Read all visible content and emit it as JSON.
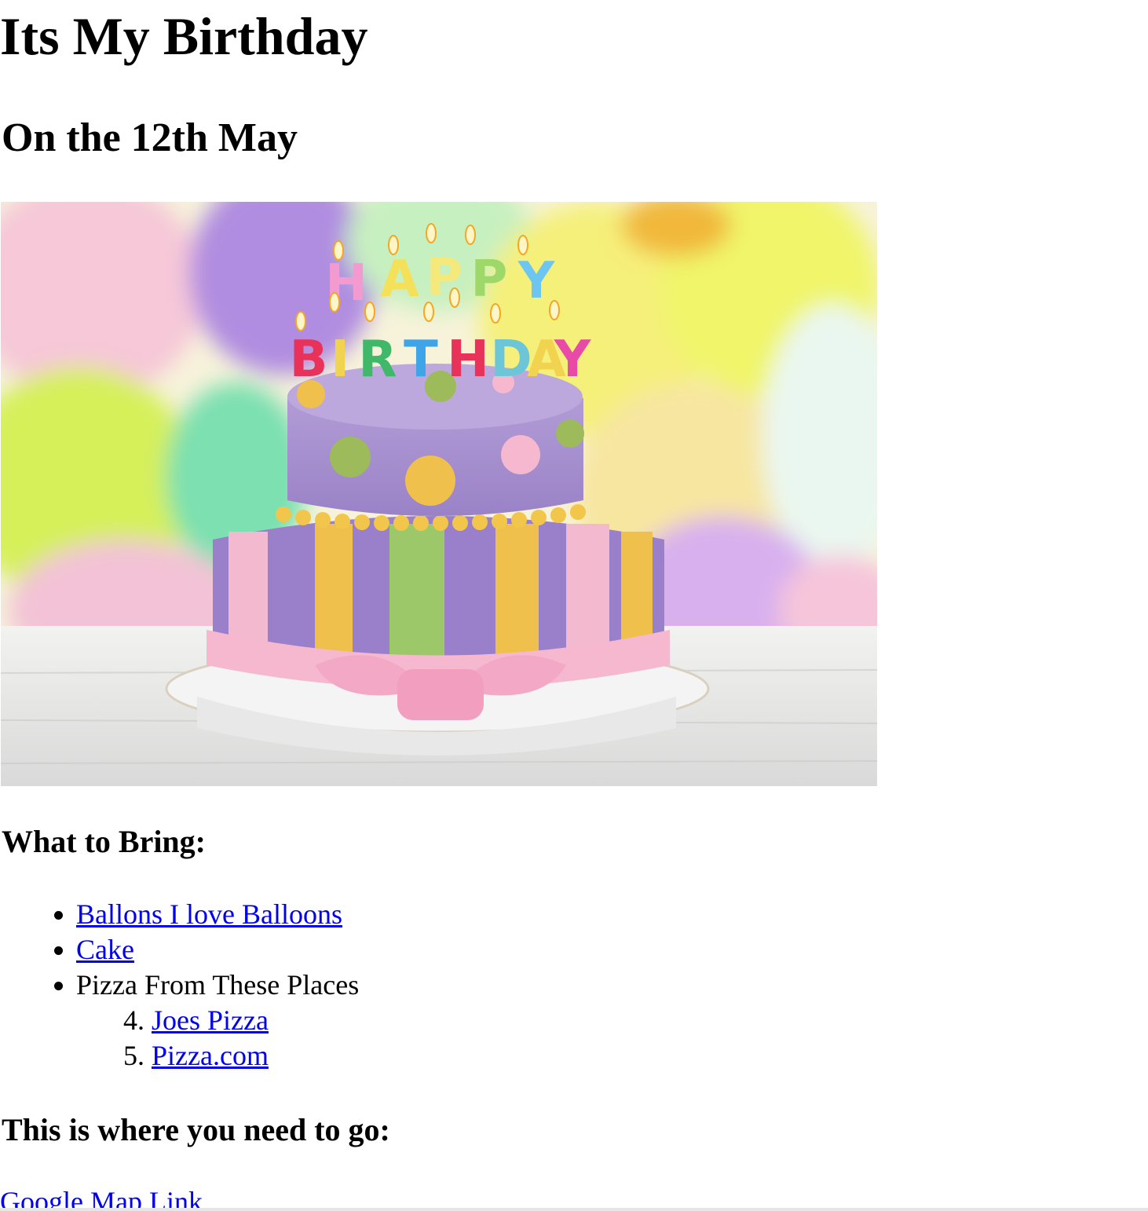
{
  "page": {
    "title": "Its My Birthday",
    "subtitle": "On the 12th May"
  },
  "bring": {
    "heading": "What to Bring:",
    "items": [
      {
        "label": "Ballons I love Balloons",
        "is_link": true
      },
      {
        "label": "Cake",
        "is_link": true
      },
      {
        "label": "Pizza From These Places",
        "is_link": false
      }
    ],
    "pizza_places": {
      "start": 4,
      "items": [
        "Joes Pizza",
        "Pizza.com"
      ]
    }
  },
  "location": {
    "heading": "This is where you need to go:",
    "map_link": "Google Map Link"
  },
  "colors": {
    "link": "#0000ee",
    "text": "#000000",
    "background": "#ffffff"
  }
}
